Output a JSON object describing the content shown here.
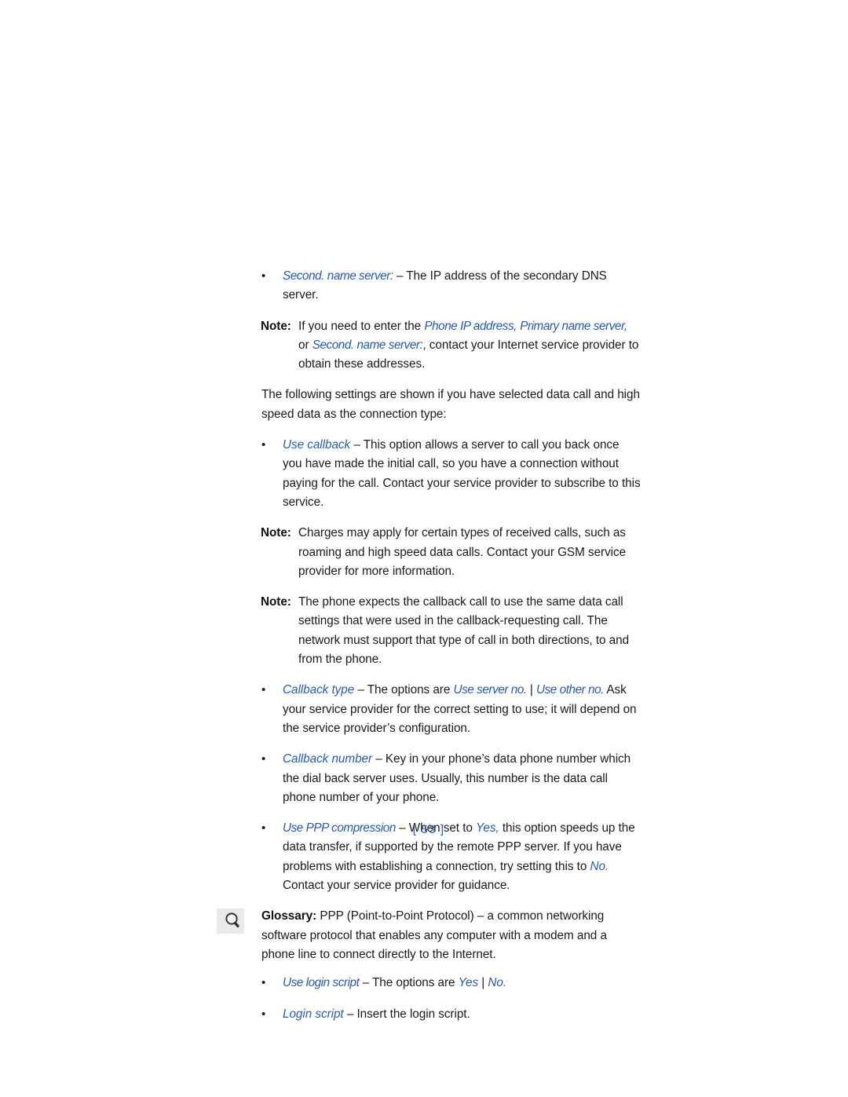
{
  "document": {
    "page_number_label": "[ 53 ]",
    "page_number": "53"
  },
  "icons": {
    "glossary_icon_name": "magnifier-icon"
  },
  "colors": {
    "accent_blue": "#2a5aa8",
    "body_text": "#1a1a1a",
    "icon_box": "#e9e9e9",
    "page_background": "#ffffff"
  },
  "labels": {
    "note": "Note:",
    "glossary": "Glossary:",
    "bullet_marker": "•",
    "option_separator": "|"
  },
  "body": {
    "bullet_second_name_server": {
      "term": "Second. name server:",
      "text": " – The IP address of the secondary DNS server."
    },
    "note_addresses": {
      "part1": "If you need to enter the ",
      "term1": "Phone IP address,",
      "part2": " ",
      "term2": "Primary name server,",
      "part3": " or ",
      "term3": "Second. name server:",
      "part4": ", contact your Internet service provider to obtain these addresses."
    },
    "intro_paragraph": "The following settings are shown if you have selected data call and high speed data as the connection type:",
    "bullet_use_callback": {
      "term": "Use callback",
      "text": " – This option allows a server to call you back once you have made the initial call, so you have a connection without paying for the call. Contact your service provider to subscribe to this service."
    },
    "note_charges": {
      "text": "Charges may apply for certain types of received calls, such as roaming and high speed data calls. Contact your GSM service provider for more information."
    },
    "note_callback_call": {
      "text": "The phone expects the callback call to use the same data call settings that were used in the callback-requesting call. The network must support that type of call in both directions, to and from the phone."
    },
    "bullet_callback_type": {
      "term": "Callback type",
      "part1": " – The options are ",
      "option1": "Use server no.",
      "separator": " | ",
      "option2": "Use other no.",
      "part2": " Ask your service provider for the correct setting to use; it will depend on the service provider’s configuration."
    },
    "bullet_callback_number": {
      "term": "Callback number",
      "text": " – Key in your phone’s data phone number which the dial back server uses. Usually, this number is the data call phone number of your phone."
    },
    "bullet_ppp_compression": {
      "term": "Use PPP compression",
      "part1": " – When set to ",
      "option1": "Yes,",
      "part2": " this option speeds up the data transfer, if supported by the remote PPP server. If you have problems with establishing a connection, try setting this to ",
      "option2": "No.",
      "part3": " Contact your service provider for guidance."
    },
    "glossary_ppp": {
      "label": "Glossary:",
      "text": " PPP (Point-to-Point Protocol) – a common networking software protocol that enables any computer with a modem and a phone line to connect directly to the Internet."
    },
    "bullet_use_login_script": {
      "term": "Use login script",
      "part1": " – The options are ",
      "option1": "Yes",
      "separator": " | ",
      "option2": "No."
    },
    "bullet_login_script": {
      "term": "Login script",
      "text": " – Insert the login script."
    }
  }
}
